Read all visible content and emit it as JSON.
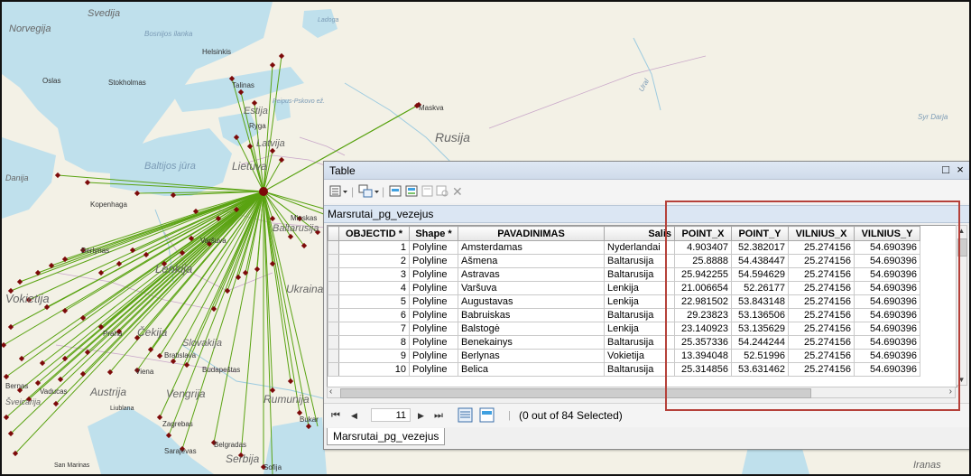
{
  "map": {
    "labels": {
      "norvegija": "Norvegija",
      "svedija": "Svedija",
      "bosnijos_ilanka": "Bosnijos ilanka",
      "helsinkis": "Helsinkis",
      "oslas": "Oslas",
      "stokholmas": "Stokholmas",
      "talinas": "Talinas",
      "estija": "Estija",
      "ryga": "Ryga",
      "latvija": "Latvija",
      "maskva": "Maskva",
      "rusija": "Rusija",
      "baltijos_jura": "Baltijos jūra",
      "lietuva": "Lietuva",
      "danija": "Danija",
      "kopenhaga": "Kopenhaga",
      "minskas": "Minskas",
      "baltarusija": "Baltarusija",
      "berlynas": "Berlynas",
      "varsuva": "Varšuva",
      "lenkija": "Lenkija",
      "ukraina": "Ukraina",
      "vokietija": "Vokietija",
      "praha": "Praha",
      "cekija": "Čekija",
      "slovakija": "Slovakija",
      "bratislava": "Bratislava",
      "viena": "Viena",
      "budapestas": "Budapeštas",
      "bernas": "Bernas",
      "vaducas": "Vaducas",
      "sveicarija": "Šveicarija",
      "austrija": "Austrija",
      "vengrija": "Vengrija",
      "liublana": "Liublana",
      "rumunija": "Rumunija",
      "bukarestas": "Bukar",
      "zagrebas": "Zagrebas",
      "belgradas": "Belgradas",
      "sarajevas": "Sarajevas",
      "serbija": "Serbija",
      "san_marinas": "San Marinas",
      "sofija": "Sofija",
      "iranas": "Iranas",
      "syr_darja": "Syr Darja",
      "ural": "Ural",
      "pskovo": "Peipus-Pskovo ež.",
      "ladoga": "Ladoga"
    }
  },
  "table_window": {
    "title": "Table",
    "controls": {
      "dock": "□",
      "close": "×"
    },
    "toolbar_icons": [
      "table-options-icon",
      "related-tables-icon",
      "select-by-attributes-icon",
      "switch-selection-icon",
      "clear-selection-icon",
      "zoom-to-selected-icon",
      "delete-selected-icon"
    ],
    "layer_tab": "Marsrutai_pg_vezejus",
    "columns": [
      "",
      "OBJECTID *",
      "Shape *",
      "PAVADINIMAS",
      "Salis",
      "POINT_X",
      "POINT_Y",
      "VILNIUS_X",
      "VILNIUS_Y"
    ],
    "rows": [
      [
        "",
        "1",
        "Polyline",
        "Amsterdamas",
        "Nyderlandai",
        "4.903407",
        "52.382017",
        "25.274156",
        "54.690396"
      ],
      [
        "",
        "2",
        "Polyline",
        "Ašmena",
        "Baltarusija",
        "25.8888",
        "54.438447",
        "25.274156",
        "54.690396"
      ],
      [
        "",
        "3",
        "Polyline",
        "Astravas",
        "Baltarusija",
        "25.942255",
        "54.594629",
        "25.274156",
        "54.690396"
      ],
      [
        "",
        "4",
        "Polyline",
        "Varšuva",
        "Lenkija",
        "21.006654",
        "52.26177",
        "25.274156",
        "54.690396"
      ],
      [
        "",
        "5",
        "Polyline",
        "Augustavas",
        "Lenkija",
        "22.981502",
        "53.843148",
        "25.274156",
        "54.690396"
      ],
      [
        "",
        "6",
        "Polyline",
        "Babruiskas",
        "Baltarusija",
        "29.23823",
        "53.136506",
        "25.274156",
        "54.690396"
      ],
      [
        "",
        "7",
        "Polyline",
        "Balstogė",
        "Lenkija",
        "23.140923",
        "53.135629",
        "25.274156",
        "54.690396"
      ],
      [
        "",
        "8",
        "Polyline",
        "Benekainys",
        "Baltarusija",
        "25.357336",
        "54.244244",
        "25.274156",
        "54.690396"
      ],
      [
        "",
        "9",
        "Polyline",
        "Berlynas",
        "Vokietija",
        "13.394048",
        "52.51996",
        "25.274156",
        "54.690396"
      ],
      [
        "",
        "10",
        "Polyline",
        "Belica",
        "Baltarusija",
        "25.314856",
        "53.631462",
        "25.274156",
        "54.690396"
      ]
    ],
    "nav": {
      "first": "⏮",
      "prev": "◀",
      "record": "11",
      "next": "▶",
      "last": "⏭",
      "status": "(0 out of 84 Selected)"
    },
    "bottom_tab": "Marsrutai_pg_vezejus"
  },
  "colors": {
    "route_line": "#5aa312",
    "point_fill": "#7d0a0a",
    "highlight_box": "#b5413a",
    "land": "#f3f1e6",
    "water": "#bfe0ec"
  }
}
